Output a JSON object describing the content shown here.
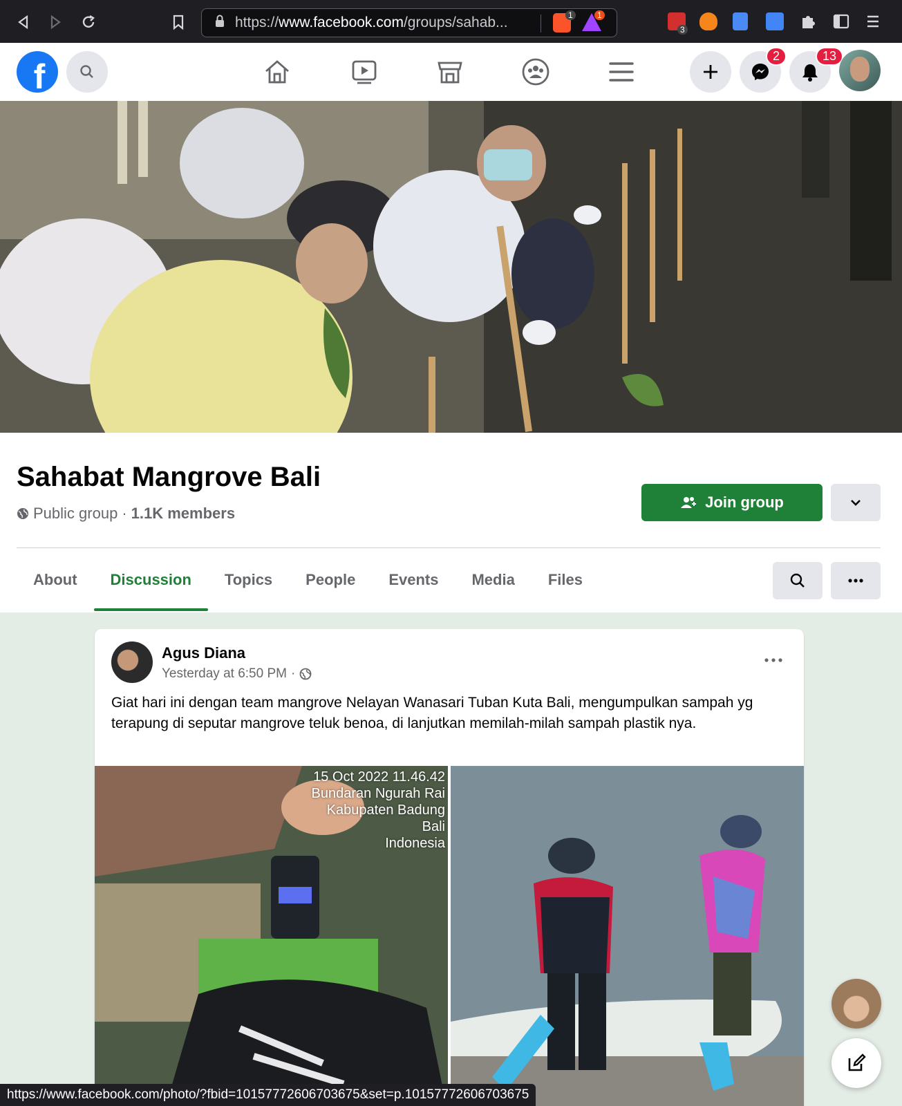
{
  "browser": {
    "url_scheme": "https://",
    "url_host": "www.facebook.com",
    "url_path": "/groups/sahab...",
    "brave_badge": "1",
    "alert_badge": "1",
    "ext_badge": "3"
  },
  "header": {
    "logo_letter": "f",
    "messenger_count": "2",
    "notifications_count": "13"
  },
  "group": {
    "name": "Sahabat Mangrove Bali",
    "privacy": "Public group",
    "separator": "·",
    "members": "1.1K members",
    "join_label": "Join group"
  },
  "tabs": [
    {
      "label": "About",
      "active": false
    },
    {
      "label": "Discussion",
      "active": true
    },
    {
      "label": "Topics",
      "active": false
    },
    {
      "label": "People",
      "active": false
    },
    {
      "label": "Events",
      "active": false
    },
    {
      "label": "Media",
      "active": false
    },
    {
      "label": "Files",
      "active": false
    }
  ],
  "post": {
    "author": "Agus Diana",
    "time": "Yesterday at 6:50 PM",
    "dot": "·",
    "text": "Giat hari ini dengan team mangrove Nelayan Wanasari Tuban Kuta Bali, mengumpulkan sampah yg terapung di seputar mangrove teluk benoa, di lanjutkan memilah-milah sampah plastik nya.",
    "image_stamp": {
      "line1": "15 Oct 2022 11.46.42",
      "line2": "Bundaran Ngurah Rai",
      "line3": "Kabupaten Badung",
      "line4": "Bali",
      "line5": "Indonesia"
    }
  },
  "status_bar": {
    "url": "https://www.facebook.com/photo/?fbid=10157772606703675&set=p.10157772606703675"
  },
  "colors": {
    "accent_green": "#1e8137",
    "facebook_blue": "#1877f2",
    "badge_red": "#e41e3f"
  }
}
